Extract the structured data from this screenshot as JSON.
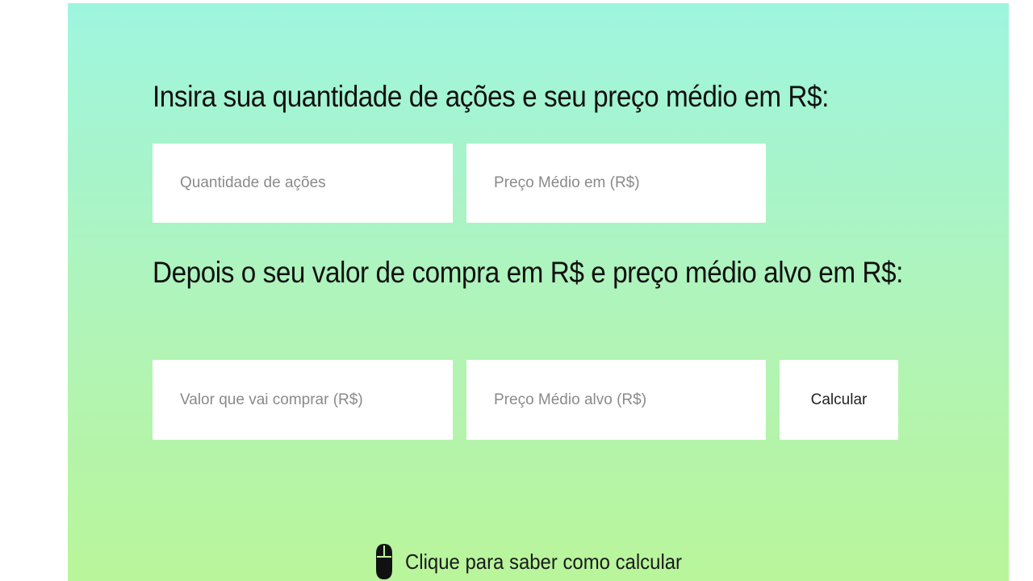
{
  "section1": {
    "heading": "Insira sua quantidade de ações e seu preço médio em R$:",
    "quantity_placeholder": "Quantidade de ações",
    "avg_price_placeholder": "Preço Médio em (R$)"
  },
  "section2": {
    "heading": "Depois o seu valor de compra em R$ e preço médio alvo em R$:",
    "buy_value_placeholder": "Valor que vai comprar (R$)",
    "target_price_placeholder": "Preço Médio alvo (R$)",
    "calculate_label": "Calcular"
  },
  "hint": {
    "icon": "mouse-icon",
    "label": "Clique para saber como calcular"
  },
  "colors": {
    "gradient_top": "#9ef5df",
    "gradient_bottom": "#b9f59a",
    "text": "#111111"
  }
}
